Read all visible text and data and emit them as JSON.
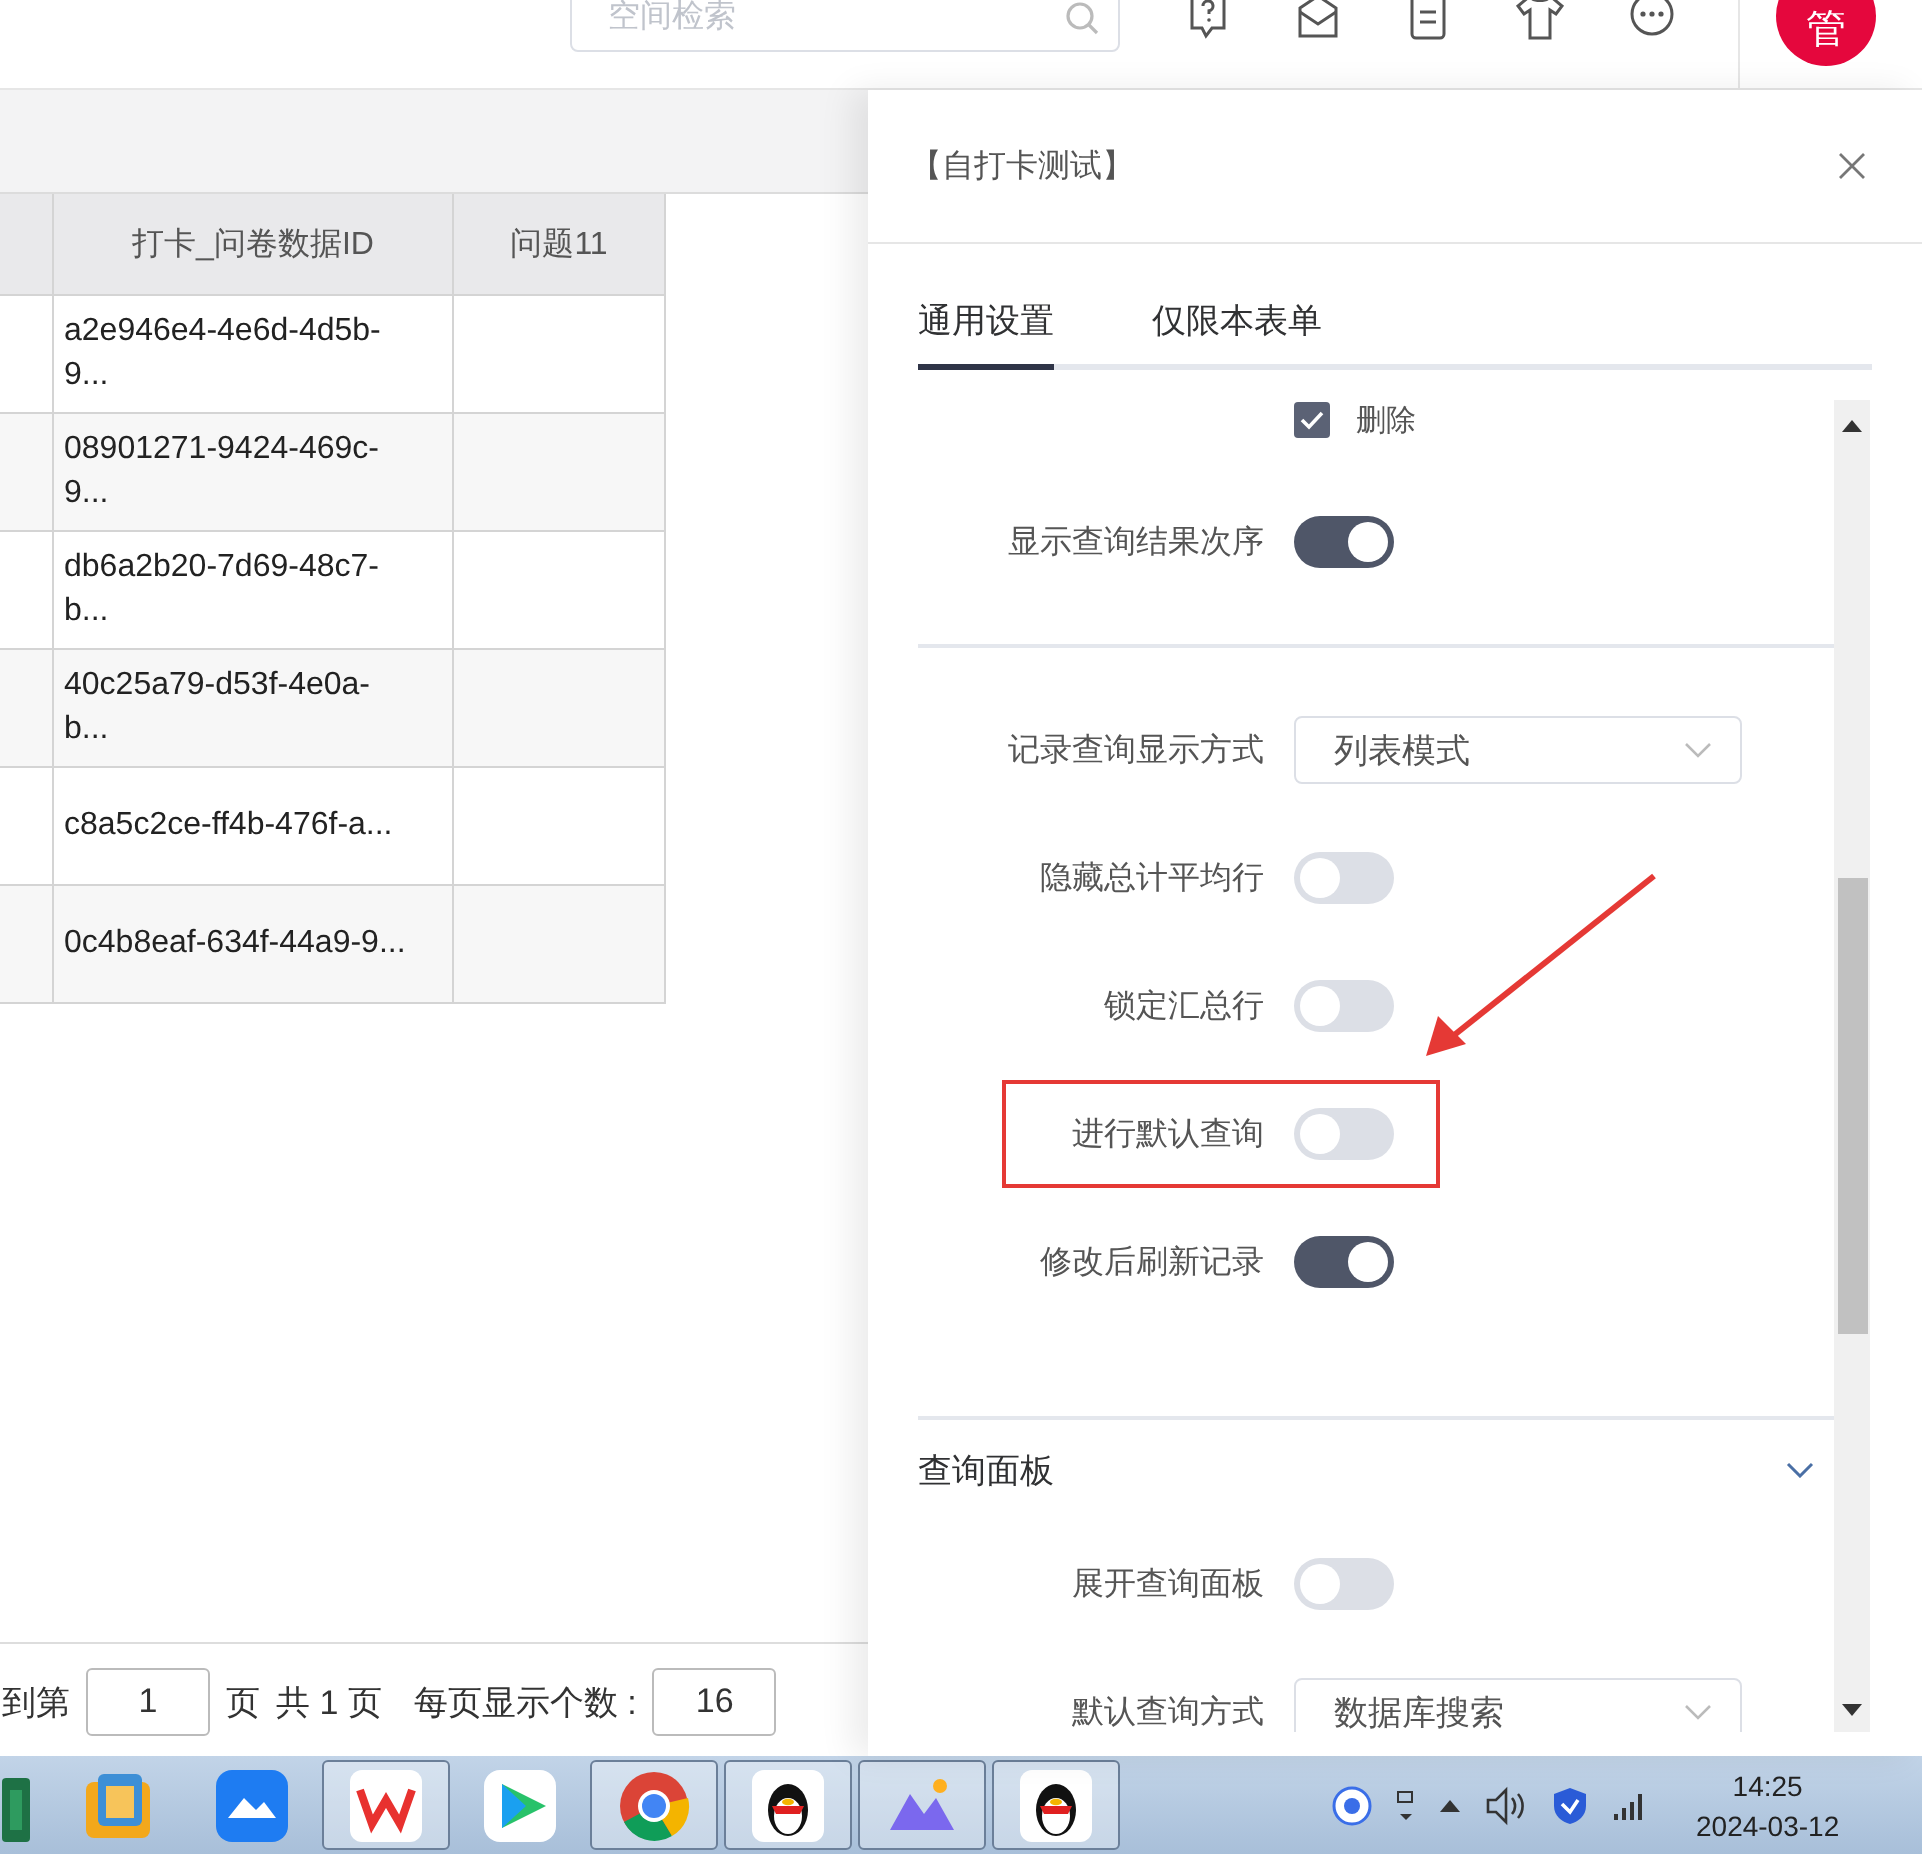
{
  "top_bar": {
    "search": {
      "placeholder": "空间检索"
    },
    "avatar": "管"
  },
  "table": {
    "columns": [
      {
        "label": "打卡_问卷数据ID"
      },
      {
        "label": "问题11"
      }
    ],
    "rows": [
      {
        "id": "a2e946e4-4e6d-4d5b-9..."
      },
      {
        "id": "08901271-9424-469c-9..."
      },
      {
        "id": "db6a2b20-7d69-48c7-b..."
      },
      {
        "id": "40c25a79-d53f-4e0a-b..."
      },
      {
        "id": "c8a5c2ce-ff4b-476f-a..."
      },
      {
        "id": "0c4b8eaf-634f-44a9-9..."
      }
    ]
  },
  "pagination": {
    "goto_label": "到第",
    "page": "1",
    "page_suffix": "页",
    "total": "共 1 页",
    "page_size_label": "每页显示个数 :",
    "page_size": "16"
  },
  "panel": {
    "title": "【自打卡测试】",
    "tabs": [
      {
        "label": "通用设置",
        "selected": true
      },
      {
        "label": "仅限本表单",
        "selected": false
      }
    ],
    "groups": [
      {
        "items": [
          {
            "kind": "checkbox",
            "label": "删除",
            "checked": true
          },
          {
            "kind": "toggle",
            "label": "显示查询结果次序",
            "on": true,
            "highlighted": false
          }
        ]
      },
      {
        "items": [
          {
            "kind": "select",
            "label": "记录查询显示方式",
            "value": "列表模式",
            "highlighted": false
          },
          {
            "kind": "toggle",
            "label": "隐藏总计平均行",
            "on": false,
            "highlighted": false
          },
          {
            "kind": "toggle",
            "label": "锁定汇总行",
            "on": false,
            "highlighted": false
          },
          {
            "kind": "toggle",
            "label": "进行默认查询",
            "on": false,
            "highlighted": true
          },
          {
            "kind": "toggle",
            "label": "修改后刷新记录",
            "on": true,
            "highlighted": false
          }
        ]
      },
      {
        "title": "查询面板",
        "expanded": true,
        "items": [
          {
            "kind": "toggle",
            "label": "展开查询面板",
            "on": false,
            "highlighted": false
          },
          {
            "kind": "select",
            "label": "默认查询方式",
            "value": "数据库搜索",
            "highlighted": false
          }
        ]
      }
    ]
  },
  "taskbar": {
    "apps": [
      {
        "kind": "sheet",
        "running": false
      },
      {
        "kind": "folder",
        "running": false
      },
      {
        "kind": "cloud",
        "running": false
      },
      {
        "kind": "zigzag",
        "running": true
      },
      {
        "kind": "play",
        "running": false
      },
      {
        "kind": "ring",
        "running": true
      },
      {
        "kind": "penguin",
        "running": true
      },
      {
        "kind": "mountain",
        "running": true
      },
      {
        "kind": "penguin",
        "running": true
      }
    ],
    "time": "14:25",
    "date": "2024-03-12"
  }
}
